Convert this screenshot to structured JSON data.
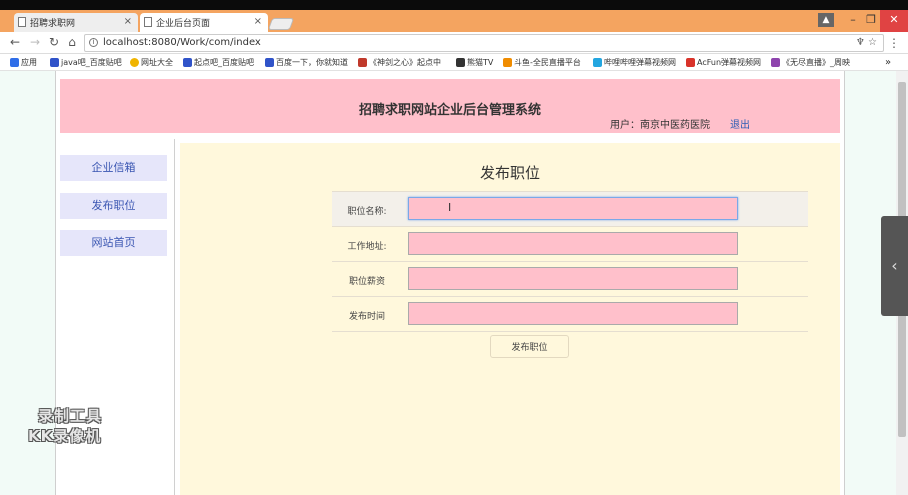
{
  "browser": {
    "tabs": [
      {
        "label": "招聘求职网"
      },
      {
        "label": "企业后台页面"
      }
    ],
    "address": "localhost:8080/Work/com/index",
    "bookmarks": [
      {
        "label": "应用",
        "color": "#2f6ee8"
      },
      {
        "label": "java吧_百度贴吧",
        "color": "#3053c9"
      },
      {
        "label": "网址大全",
        "color": "#f0b400"
      },
      {
        "label": "起点吧_百度贴吧",
        "color": "#3053c9"
      },
      {
        "label": "百度一下，你就知道",
        "color": "#3053c9"
      },
      {
        "label": "《神剑之心》起点中",
        "color": "#c0392b"
      },
      {
        "label": "熊猫TV",
        "color": "#333333"
      },
      {
        "label": "斗鱼-全民直播平台",
        "color": "#f08c00"
      },
      {
        "label": "哔哩哔哩弹幕视频网",
        "color": "#23a6e0"
      },
      {
        "label": "AcFun弹幕视频网",
        "color": "#d9332a"
      },
      {
        "label": "《无尽直播》_周映",
        "color": "#8e44ad"
      }
    ],
    "more": "»"
  },
  "header": {
    "title": "招聘求职网站企业后台管理系统",
    "user_label": "用户：南京中医药医院",
    "logout": "退出"
  },
  "sidebar": {
    "items": [
      {
        "label": "企业信箱"
      },
      {
        "label": "发布职位"
      },
      {
        "label": "网站首页"
      }
    ]
  },
  "form": {
    "title": "发布职位",
    "fields": [
      {
        "label": "职位名称:",
        "value": ""
      },
      {
        "label": "工作地址:",
        "value": ""
      },
      {
        "label": "职位薪资",
        "value": ""
      },
      {
        "label": "发布时间",
        "value": ""
      }
    ],
    "submit_label": "发布职位"
  },
  "watermark": {
    "line1": "录制工具",
    "line2": "KK录像机"
  }
}
